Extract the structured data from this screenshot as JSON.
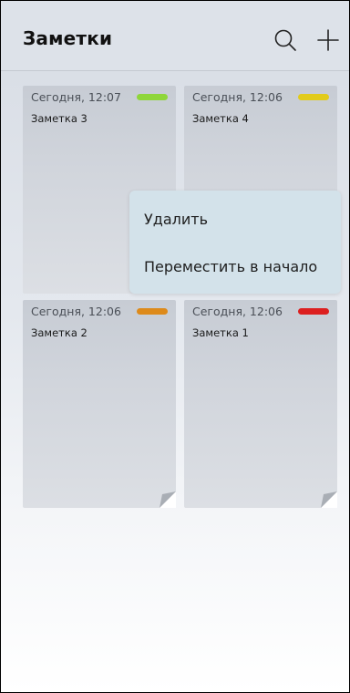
{
  "header": {
    "title": "Заметки",
    "search_icon": "search-icon",
    "add_icon": "plus-icon"
  },
  "notes": [
    {
      "date": "Сегодня, 12:07",
      "title": "Заметка 3",
      "tag_color": "#8fd63a"
    },
    {
      "date": "Сегодня, 12:06",
      "title": "Заметка 4",
      "tag_color": "#e2cb1b"
    },
    {
      "date": "Сегодня, 12:06",
      "title": "Заметка 2",
      "tag_color": "#dd8a1a"
    },
    {
      "date": "Сегодня, 12:06",
      "title": "Заметка 1",
      "tag_color": "#dc1f1f"
    }
  ],
  "context_menu": {
    "delete_label": "Удалить",
    "move_to_top_label": "Переместить в начало"
  }
}
